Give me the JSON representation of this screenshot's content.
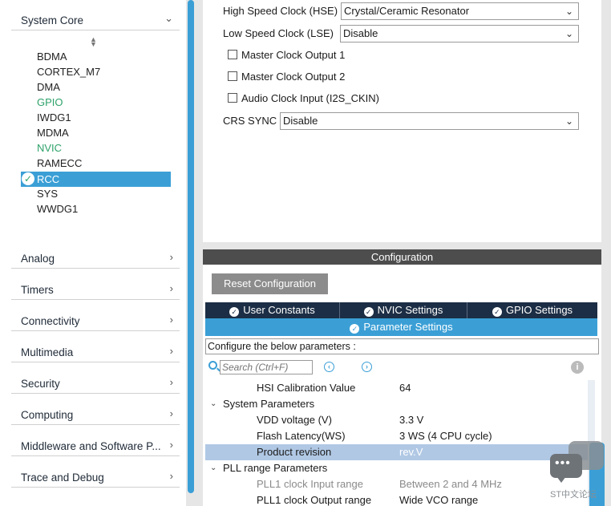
{
  "left_panel": {
    "system_core": "System Core",
    "peripherals": [
      {
        "name": "BDMA",
        "color": "#222222"
      },
      {
        "name": "CORTEX_M7",
        "color": "#222222"
      },
      {
        "name": "DMA",
        "color": "#222222"
      },
      {
        "name": "GPIO",
        "color": "#2ea26a"
      },
      {
        "name": "IWDG1",
        "color": "#222222"
      },
      {
        "name": "MDMA",
        "color": "#222222"
      },
      {
        "name": "NVIC",
        "color": "#2ea26a"
      },
      {
        "name": "RAMECC",
        "color": "#222222"
      },
      {
        "name": "RCC",
        "color": "#ffffff",
        "selected": true
      },
      {
        "name": "SYS",
        "color": "#222222"
      },
      {
        "name": "WWDG1",
        "color": "#222222"
      }
    ],
    "categories": [
      "Analog",
      "Timers",
      "Connectivity",
      "Multimedia",
      "Security",
      "Computing",
      "Middleware and Software P...",
      "Trace and Debug"
    ]
  },
  "mode": {
    "hse_label": "High Speed Clock (HSE)",
    "hse_value": "Crystal/Ceramic Resonator",
    "lse_label": "Low Speed Clock (LSE)",
    "lse_value": "Disable",
    "mco1_label": "Master Clock Output 1",
    "mco2_label": "Master Clock Output 2",
    "audio_label": "Audio Clock Input (I2S_CKIN)",
    "crs_label": "CRS SYNC",
    "crs_value": "Disable"
  },
  "config": {
    "header": "Configuration",
    "reset_button": "Reset Configuration",
    "tabs": [
      "User Constants",
      "NVIC Settings",
      "GPIO Settings"
    ],
    "active_tab": "Parameter Settings",
    "configure_text": "Configure the below parameters :",
    "search_placeholder": "Search (Ctrl+F)",
    "params": {
      "hsi_cal_name": "HSI Calibration Value",
      "hsi_cal_value": "64",
      "group_system": "System Parameters",
      "vdd_name": "VDD voltage (V)",
      "vdd_value": "3.3 V",
      "flash_name": "Flash Latency(WS)",
      "flash_value": "3 WS (4 CPU cycle)",
      "rev_name": "Product revision",
      "rev_value": "rev.V",
      "group_pll": "PLL range Parameters",
      "pll1_in_name": "PLL1 clock Input range",
      "pll1_in_value": "Between 2 and 4 MHz",
      "pll1_out_name": "PLL1 clock Output range",
      "pll1_out_value": "Wide VCO range"
    }
  },
  "watermark": "ST中文论坛",
  "colors": {
    "accent": "#3b9fd6",
    "tab_dark": "#1c2e45",
    "enabled_green": "#2ea26a"
  }
}
